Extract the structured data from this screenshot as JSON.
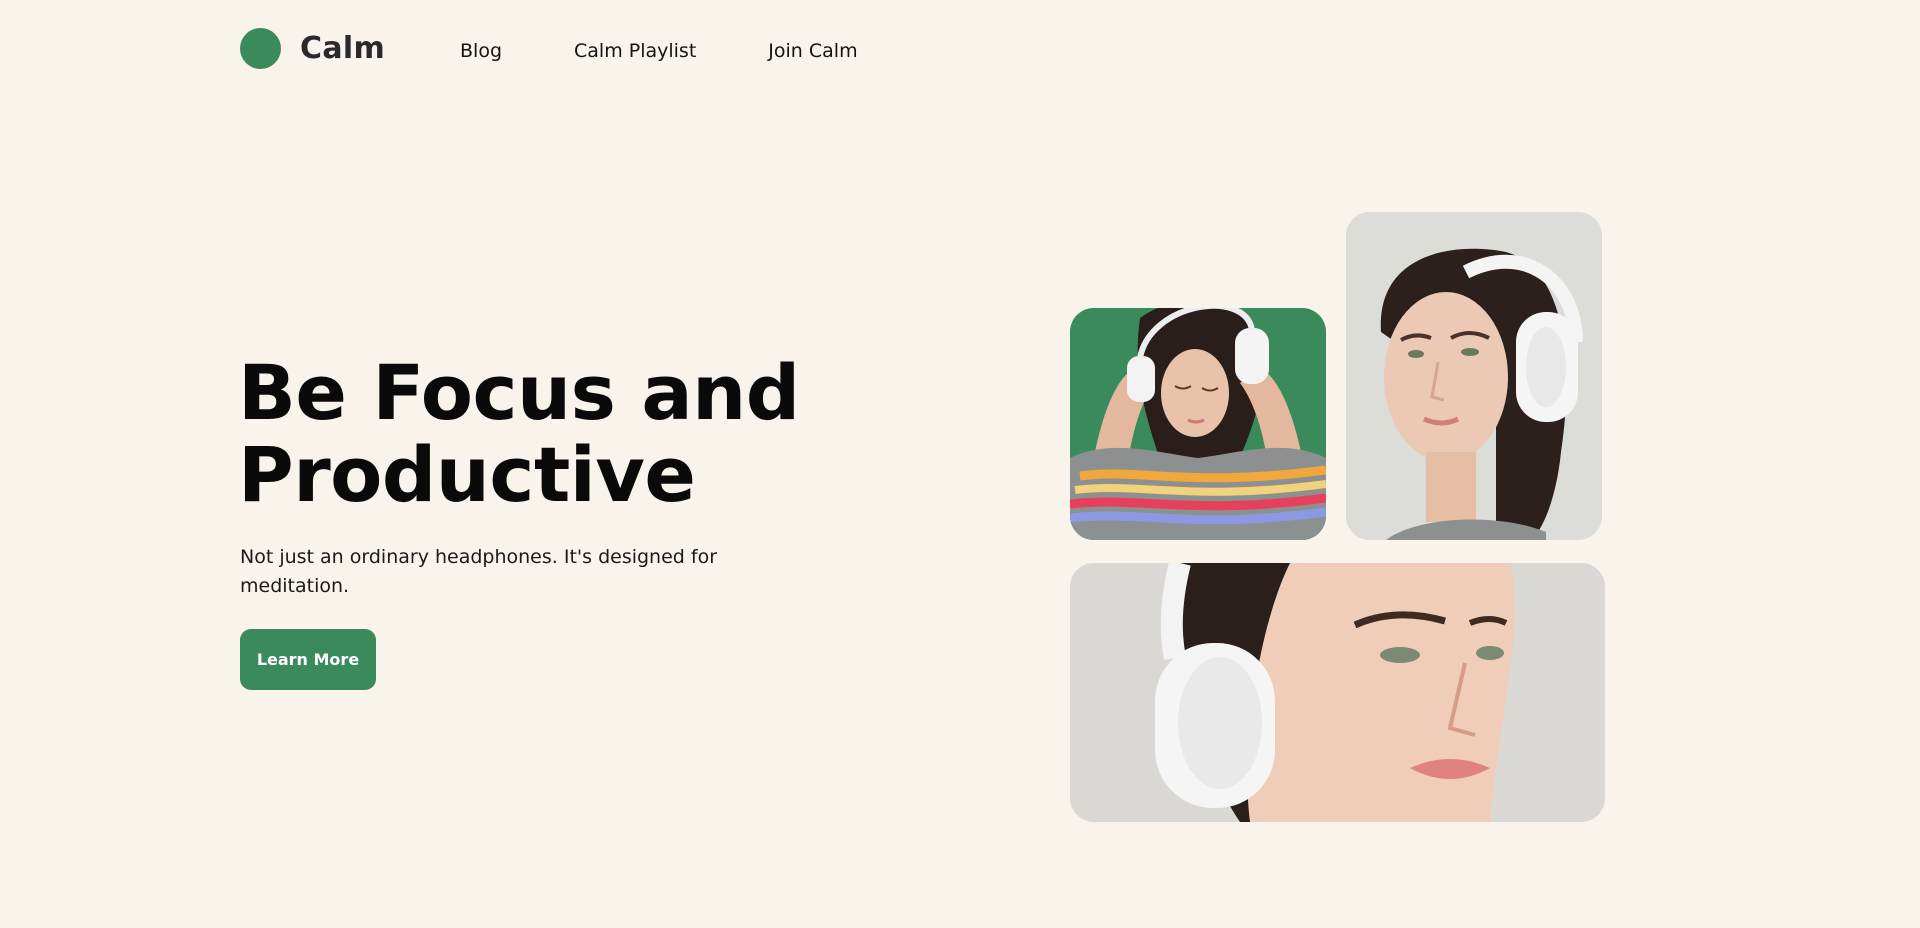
{
  "brand": {
    "name": "Calm",
    "color": "#3a8a5c"
  },
  "nav": {
    "items": [
      {
        "label": "Blog"
      },
      {
        "label": "Calm Playlist"
      },
      {
        "label": "Join Calm"
      }
    ]
  },
  "hero": {
    "title_line1": "Be Focus and",
    "title_line2": "Productive",
    "subtitle": "Not just an ordinary headphones. It's designed for meditation.",
    "cta_label": "Learn More"
  },
  "images": [
    {
      "name": "woman-with-headphones-green-bg",
      "icon": "photo-woman-headphones"
    },
    {
      "name": "woman-with-headphones-portrait",
      "icon": "photo-woman-headphones"
    },
    {
      "name": "woman-with-headphones-closeup",
      "icon": "photo-woman-headphones"
    }
  ],
  "colors": {
    "background": "#f8f4ec",
    "accent": "#3a8a5c",
    "text": "#0a0a0a"
  }
}
